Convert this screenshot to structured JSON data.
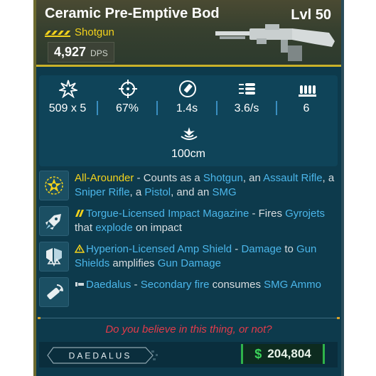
{
  "header": {
    "title": "Ceramic Pre-Emptive Bod",
    "level": "Lvl 50",
    "weapon_type": "Shotgun",
    "dps_value": "4,927",
    "dps_label": "DPS",
    "rarity_color": "#f3d21c"
  },
  "stats": [
    {
      "icon": "damage-burst-icon",
      "value": "509 x 5"
    },
    {
      "icon": "crosshair-icon",
      "value": "67%"
    },
    {
      "icon": "reload-icon",
      "value": "1.4s"
    },
    {
      "icon": "fire-rate-icon",
      "value": "3.6/s"
    },
    {
      "icon": "magazine-icon",
      "value": "6"
    },
    {
      "icon": "range-icon",
      "value": "100cm"
    }
  ],
  "perks": [
    {
      "icon": "star-badge-icon",
      "name": "All-Arounder",
      "t1": " - Counts as a ",
      "k1": "Shotgun",
      "t2": ", an ",
      "k2": "Assault Rifle",
      "t3": ", a ",
      "k3": "Sniper Rifle",
      "t4": ", a ",
      "k4": "Pistol",
      "t5": ", and an ",
      "k5": "SMG"
    },
    {
      "icon": "rocket-icon",
      "name": "Torgue-Licensed Impact Magazine",
      "t1": " - Fires ",
      "k1": "Gyrojets",
      "t2": " that ",
      "k2": "explode",
      "t3": " on impact"
    },
    {
      "icon": "amp-shield-icon",
      "name": "Hyperion-Licensed Amp Shield",
      "t1": " - ",
      "k1": "Damage",
      "t2": " to ",
      "k2": "Gun Shields",
      "t3": " amplifies ",
      "k3": "Gun Damage"
    },
    {
      "icon": "secondary-fire-icon",
      "name": "Daedalus",
      "t1": " - ",
      "k1": "Secondary fire",
      "t2": " consumes ",
      "k2": "SMG Ammo"
    }
  ],
  "footer": {
    "flavor_text": "Do you believe in this thing, or not?",
    "manufacturer": "DAEDALUS",
    "price_symbol": "$",
    "price": "204,804",
    "price_color": "#3bd35a"
  }
}
